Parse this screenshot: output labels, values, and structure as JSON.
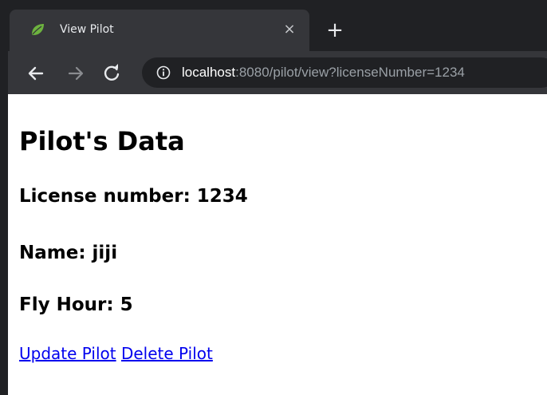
{
  "browser": {
    "tab_title": "View Pilot",
    "tab_close": "×",
    "new_tab": "+",
    "url_host": "localhost",
    "url_rest": ":8080/pilot/view?licenseNumber=1234",
    "favicon": "spring-leaf-icon",
    "colors": {
      "tabstrip": "#202124",
      "toolbar": "#35363a",
      "favicon": "#6db33f",
      "link": "#0000ee"
    }
  },
  "page": {
    "title": "Pilot's Data",
    "license_line": "License number: 1234",
    "name_line": "Name: jiji",
    "fly_hour_line": "Fly Hour: 5",
    "update_link": "Update Pilot",
    "delete_link": "Delete Pilot"
  }
}
